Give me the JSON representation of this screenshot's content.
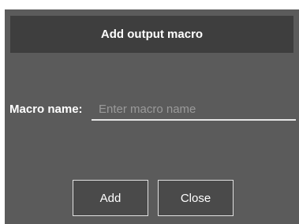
{
  "dialog": {
    "title": "Add output macro",
    "macro_name": {
      "label": "Macro name:",
      "value": "",
      "placeholder": "Enter macro name"
    },
    "buttons": {
      "add_label": "Add",
      "close_label": "Close"
    }
  },
  "colors": {
    "dialog_background": "#5b5b5b",
    "title_bar_background": "#3e3e3e",
    "button_background": "#4a4a4a",
    "text": "#ffffff",
    "placeholder": "#9a9a9a"
  }
}
